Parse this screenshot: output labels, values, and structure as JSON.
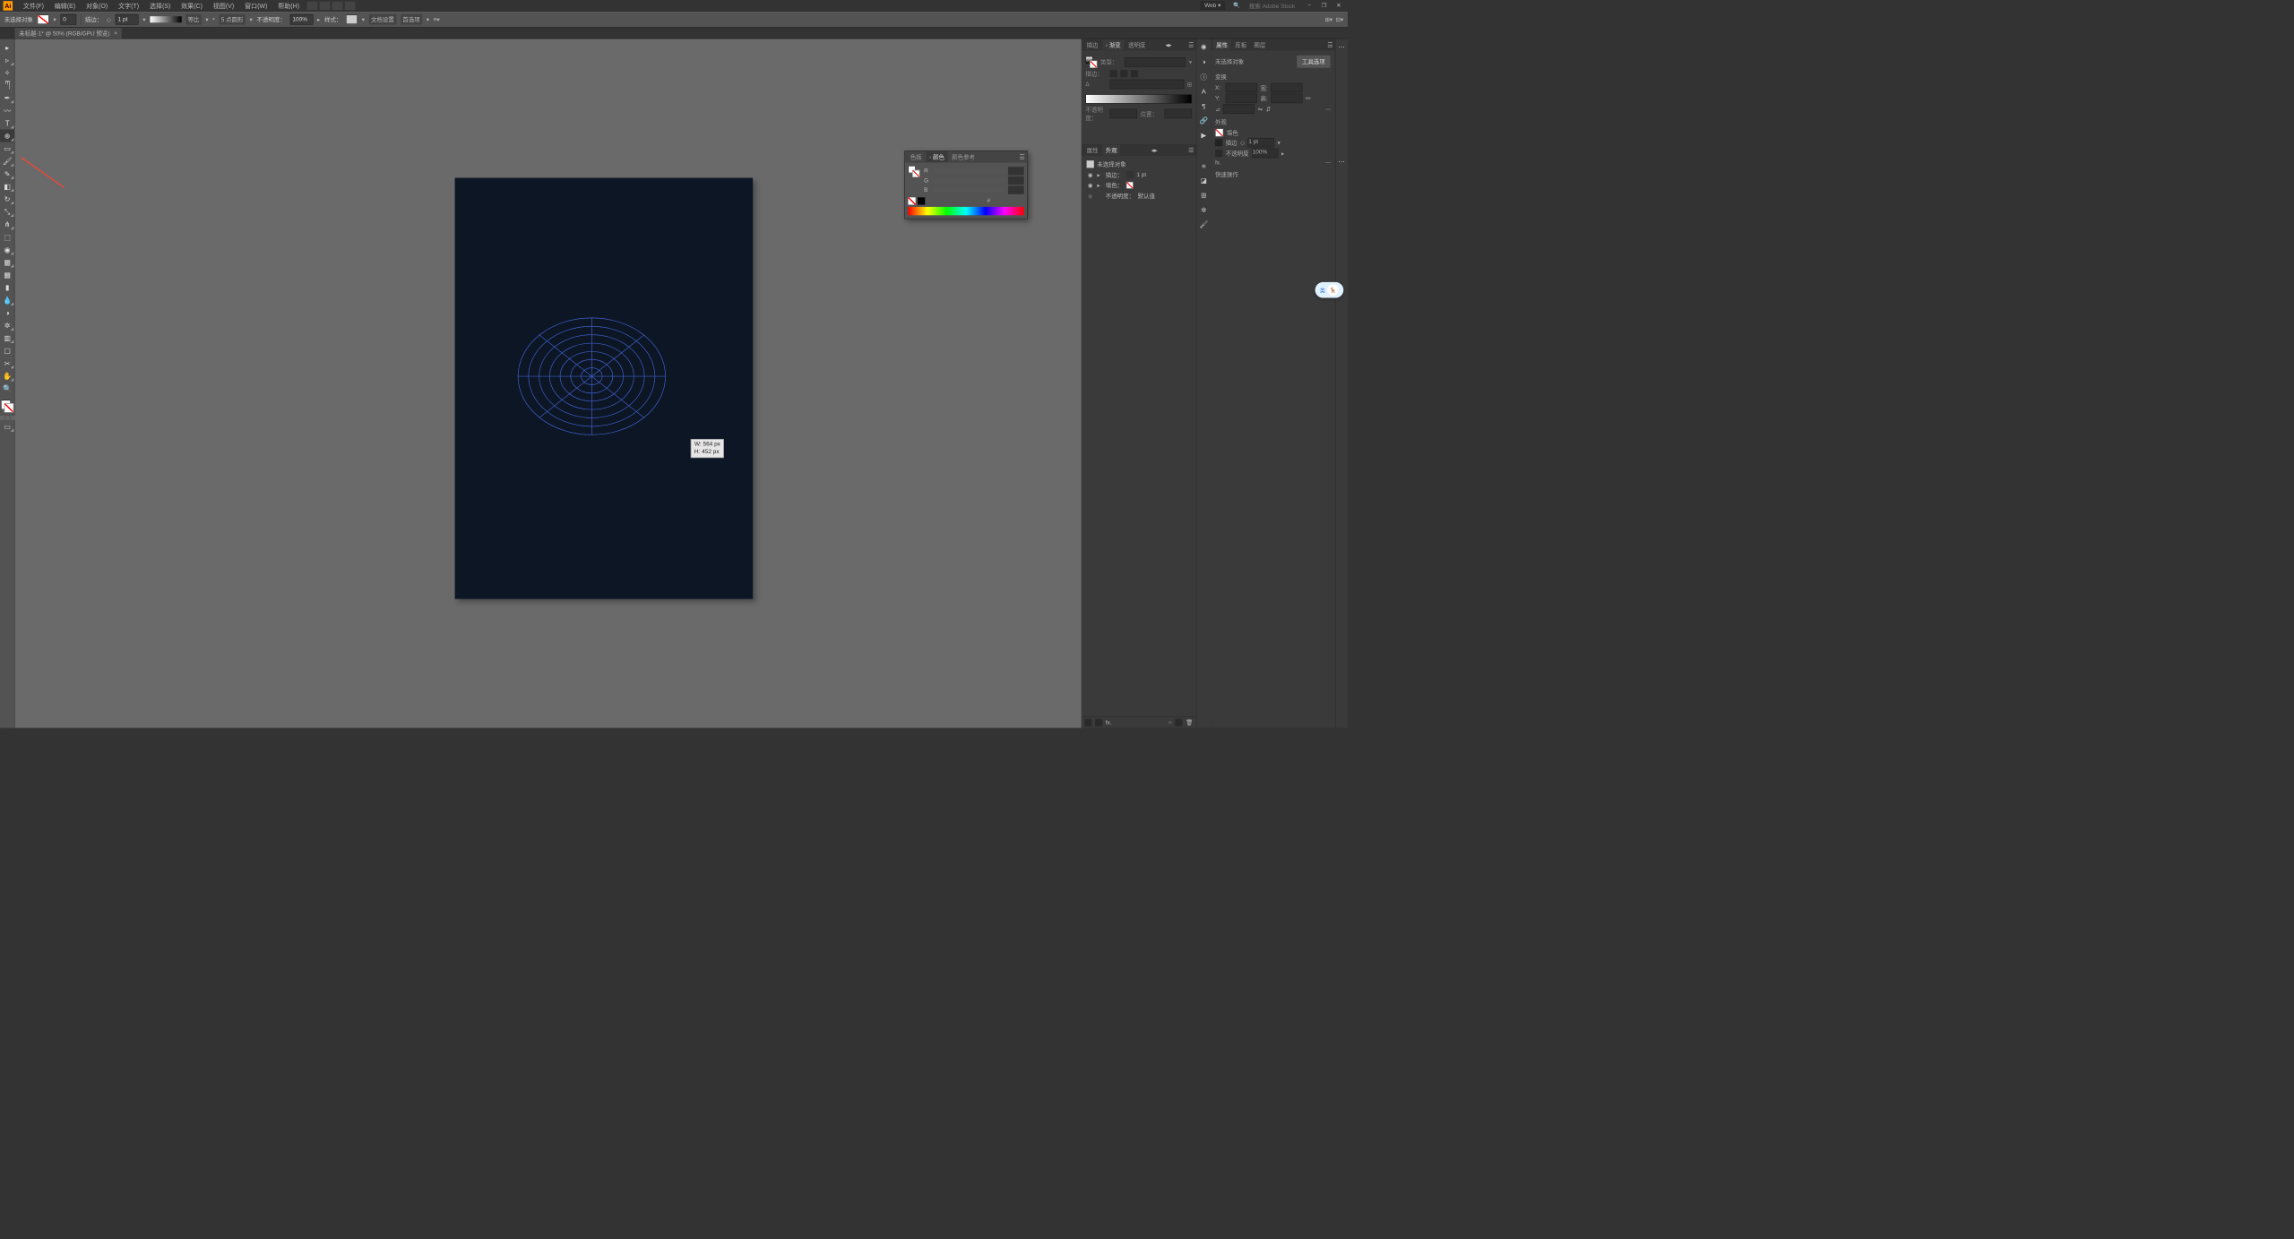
{
  "app": {
    "logo": "Ai"
  },
  "menu": {
    "file": "文件(F)",
    "edit": "编辑(E)",
    "object": "对象(O)",
    "type": "文字(T)",
    "select": "选择(S)",
    "effect": "效果(C)",
    "view": "视图(V)",
    "window": "窗口(W)",
    "help": "帮助(H)"
  },
  "workspace_selector": "Web",
  "search_placeholder": "搜索 Adobe Stock",
  "control": {
    "no_selection": "未选择对象",
    "stroke_label": "描边：",
    "stroke_weight": "1 pt",
    "uniform": "等比",
    "corner": "5 点圆形",
    "opacity_label": "不透明度：",
    "opacity": "100%",
    "style_label": "样式：",
    "doc_setup": "文档设置",
    "prefs": "首选项",
    "fill_val": "0"
  },
  "document_tab": {
    "title": "未标题-1* @ 50% (RGB/GPU 预览)"
  },
  "tooltip": {
    "w_label": "W:",
    "w_val": "564 px",
    "h_label": "H:",
    "h_val": "452 px"
  },
  "float_color": {
    "tab_swatches": "色板",
    "tab_color": "颜色",
    "tab_guide": "颜色参考",
    "r": "R",
    "g": "G",
    "b": "B",
    "hex_prefix": "#"
  },
  "gradient_panel": {
    "tab_stroke": "描边",
    "tab_gradient": "渐变",
    "tab_transparency": "透明度",
    "type_label": "类型：",
    "stroke_row": "描边：",
    "angle": "Δ",
    "opacity_label": "不透明度：",
    "position_label": "位置："
  },
  "appearance_panel": {
    "tab_properties": "属性",
    "tab_appearance": "外观",
    "no_selection": "未选择对象",
    "stroke": "描边：",
    "stroke_val": "1 pt",
    "fill": "填色：",
    "opacity": "不透明度：",
    "opacity_val": "默认值"
  },
  "properties_panel": {
    "tab_properties": "属性",
    "tab_libraries": "库板",
    "tab_layers": "图层",
    "no_selection": "未选择对象",
    "btn_tool_options": "工具选项",
    "sec_transform": "变换",
    "x": "X:",
    "y": "Y:",
    "w": "宽:",
    "h": "高:",
    "sec_appearance": "外观",
    "fill": "填色",
    "stroke": "描边",
    "stroke_val": "1 pt",
    "opacity": "不透明度",
    "opacity_val": "100%",
    "fx": "fx.",
    "sec_quick": "快速操作"
  },
  "tools": [
    "selection",
    "direct-selection",
    "magic-wand",
    "lasso",
    "pen",
    "curvature",
    "type",
    "line",
    "polar-grid",
    "rectangle",
    "paintbrush",
    "pencil",
    "eraser",
    "rotate",
    "scale",
    "width",
    "free-transform",
    "shape-builder",
    "perspective",
    "mesh",
    "gradient",
    "eyedropper",
    "blend",
    "symbol-sprayer",
    "column-graph",
    "artboard",
    "slice",
    "hand",
    "zoom"
  ]
}
